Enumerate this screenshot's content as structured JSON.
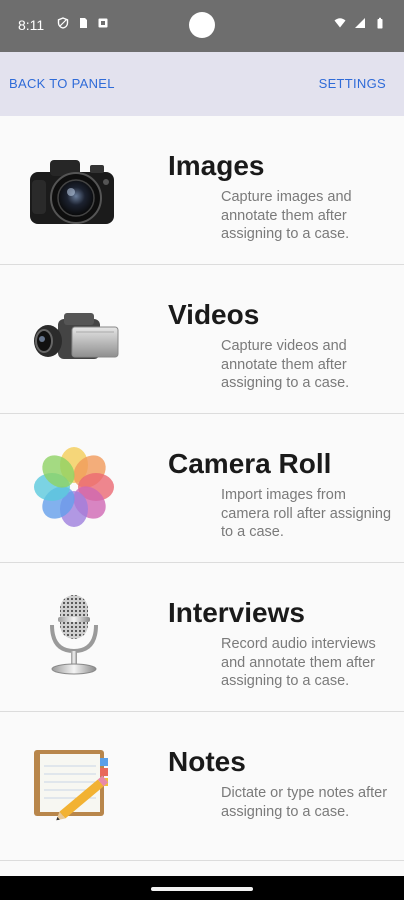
{
  "status_bar": {
    "time": "8:11"
  },
  "nav": {
    "back_label": "BACK TO PANEL",
    "settings_label": "SETTINGS"
  },
  "items": [
    {
      "title": "Images",
      "description": "Capture images and annotate them after assigning to a case.",
      "icon": "camera-icon"
    },
    {
      "title": "Videos",
      "description": "Capture videos and annotate them after assigning to a case.",
      "icon": "video-camera-icon"
    },
    {
      "title": "Camera Roll",
      "description": "Import images from camera roll after assigning to a case.",
      "icon": "photos-flower-icon"
    },
    {
      "title": "Interviews",
      "description": "Record audio interviews and annotate them after assigning to a case.",
      "icon": "microphone-icon"
    },
    {
      "title": "Notes",
      "description": "Dictate or type notes after assigning to a case.",
      "icon": "notepad-pencil-icon"
    }
  ],
  "colors": {
    "accent": "#2f6bd8",
    "status_bar": "#6e6e6e",
    "nav_bar": "#e3e2ee",
    "list_bg": "#fafafa"
  }
}
